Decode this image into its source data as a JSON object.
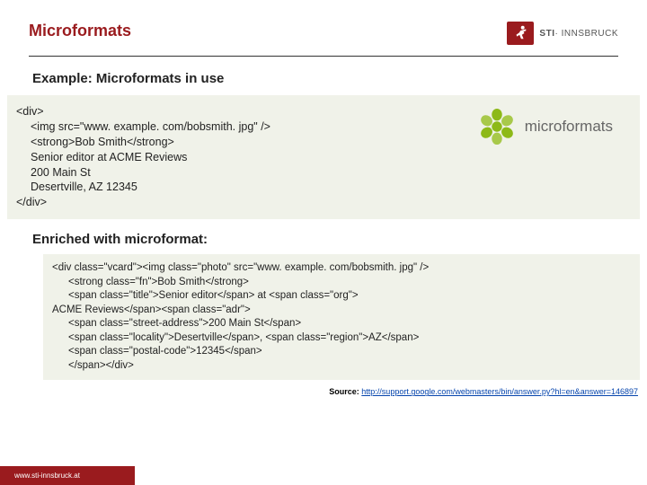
{
  "header": {
    "title": "Microformats",
    "logo_text": "STI",
    "logo_sub": "· INNSBRUCK"
  },
  "subtitle": "Example: Microformats in use",
  "code1": {
    "l1": "<div>",
    "l2": "<img src=\"www. example. com/bobsmith. jpg\" />",
    "l3": "<strong>Bob Smith</strong>",
    "l4": "Senior editor at ACME Reviews",
    "l5": "200 Main St",
    "l6": "Desertville, AZ 12345",
    "l7": "</div>"
  },
  "mf_logo_text": "microformats",
  "enriched": "Enriched with microformat:",
  "code2": {
    "l1": "<div class=\"vcard\"><img class=\"photo\" src=\"www. example. com/bobsmith. jpg\" />",
    "l2": "<strong class=\"fn\">Bob Smith</strong>",
    "l3": "<span class=\"title\">Senior editor</span> at <span class=\"org\">",
    "l4": "ACME Reviews</span><span class=\"adr\">",
    "l5": "<span class=\"street-address\">200 Main St</span>",
    "l6": "<span class=\"locality\">Desertville</span>, <span class=\"region\">AZ</span>",
    "l7": "<span class=\"postal-code\">12345</span>",
    "l8": "</span></div>"
  },
  "source": {
    "label": "Source: ",
    "url": "http://support.google.com/webmasters/bin/answer.py?hl=en&answer=146897"
  },
  "footer": "www.sti-innsbruck.at"
}
